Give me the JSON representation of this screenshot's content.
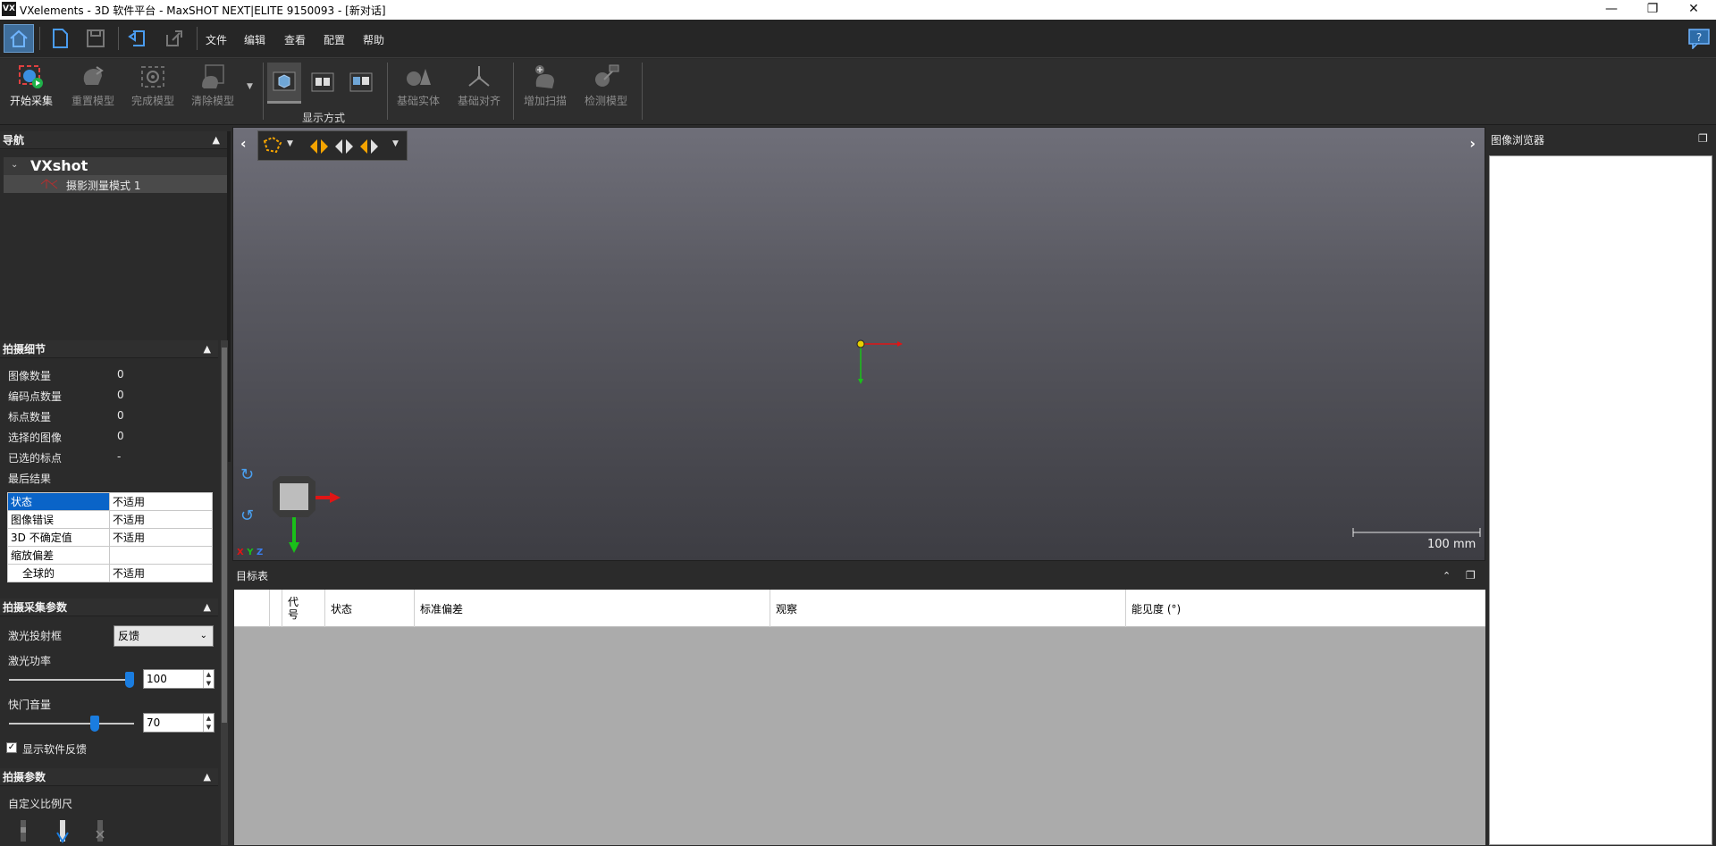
{
  "window": {
    "logo": "VX",
    "title": "VXelements - 3D 软件平台 - MaxSHOT NEXT|ELITE 9150093 - [新对话]",
    "minimize": "—",
    "restore": "❐",
    "close": "✕"
  },
  "menu": {
    "items": [
      "文件",
      "编辑",
      "查看",
      "配置",
      "帮助"
    ]
  },
  "ribbon": {
    "buttons": {
      "start": "开始采集",
      "reset": "重置模型",
      "finalize": "完成模型",
      "clear": "清除模型",
      "entities": "基础实体",
      "align": "基础对齐",
      "add_scan": "增加扫描",
      "inspect": "检测模型"
    },
    "display_group": "显示方式"
  },
  "navigation": {
    "header": "导航",
    "root": "VXshot",
    "child": "摄影测量模式 1"
  },
  "capture_details": {
    "header": "拍摄细节",
    "rows": [
      {
        "label": "图像数量",
        "value": "0"
      },
      {
        "label": "编码点数量",
        "value": "0"
      },
      {
        "label": "标点数量",
        "value": "0"
      },
      {
        "label": "选择的图像",
        "value": "0"
      },
      {
        "label": "已选的标点",
        "value": "-"
      }
    ],
    "last_result_label": "最后结果",
    "result_table": [
      {
        "key": "状态",
        "value": "不适用"
      },
      {
        "key": "图像错误",
        "value": "不适用"
      },
      {
        "key": "3D 不确定值",
        "value": "不适用"
      },
      {
        "key": "缩放偏差",
        "value": ""
      },
      {
        "key": "全球的",
        "value": "不适用"
      }
    ]
  },
  "acquisition_params": {
    "header": "拍摄采集参数",
    "laser_frame_label": "激光投射框",
    "laser_frame_value": "反馈",
    "laser_power_label": "激光功率",
    "laser_power_value": "100",
    "laser_power_level": 1.0,
    "shutter_label": "快门音量",
    "shutter_value": "70",
    "shutter_level": 0.7,
    "show_feedback_label": "显示软件反馈",
    "show_feedback_checked": "✓"
  },
  "shoot_params": {
    "header": "拍摄参数",
    "custom_scale_label": "自定义比例尺"
  },
  "viewport": {
    "scale_label": "100 mm",
    "xyz": [
      "X",
      "Y",
      "Z"
    ]
  },
  "targets": {
    "header": "目标表",
    "columns": [
      "代\n号",
      "状态",
      "标准偏差",
      "观察",
      "能见度 (°)"
    ]
  },
  "image_browser": {
    "header": "图像浏览器"
  },
  "colors": {
    "accent_blue": "#1a7de0",
    "selection_blue": "#0a64c8",
    "axis_red": "#e01515",
    "axis_green": "#19c019",
    "tool_orange": "#f5a400"
  }
}
